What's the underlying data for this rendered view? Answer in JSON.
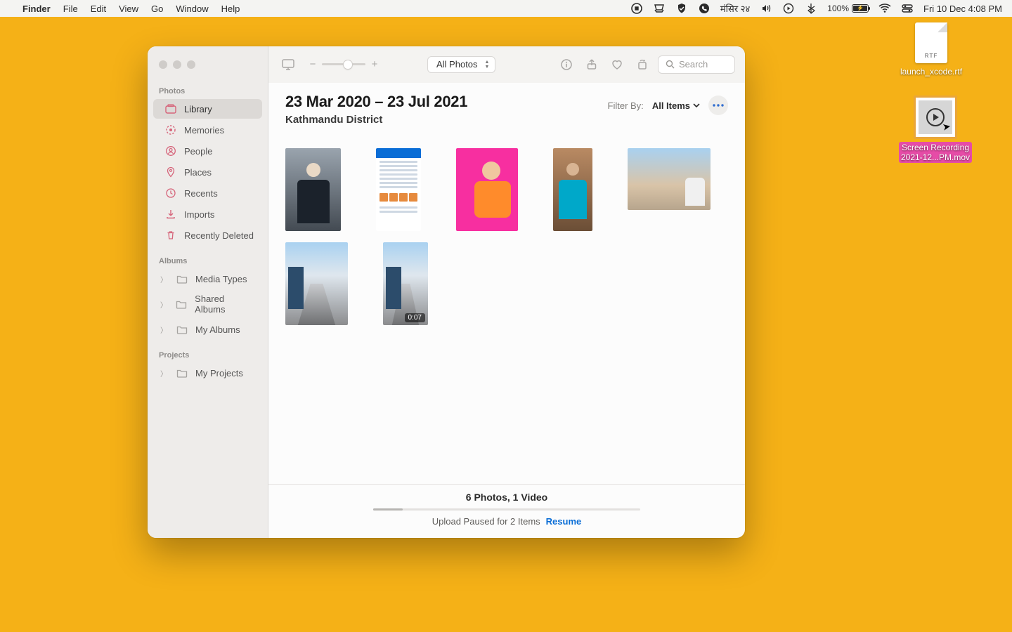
{
  "menubar": {
    "app_name": "Finder",
    "menus": [
      "File",
      "Edit",
      "View",
      "Go",
      "Window",
      "Help"
    ],
    "status": {
      "date_text": "मंसिर २४",
      "battery_pct": "100%",
      "clock": "Fri 10 Dec  4:08 PM"
    }
  },
  "window": {
    "traffic_lights": [
      "close",
      "minimize",
      "zoom"
    ],
    "sidebar": {
      "sections": [
        {
          "label": "Photos",
          "items": [
            {
              "icon": "photos-icon",
              "label": "Library",
              "active": true
            },
            {
              "icon": "memories-icon",
              "label": "Memories"
            },
            {
              "icon": "people-icon",
              "label": "People"
            },
            {
              "icon": "places-icon",
              "label": "Places"
            },
            {
              "icon": "recents-icon",
              "label": "Recents"
            },
            {
              "icon": "imports-icon",
              "label": "Imports"
            },
            {
              "icon": "trash-icon",
              "label": "Recently Deleted"
            }
          ]
        },
        {
          "label": "Albums",
          "items": [
            {
              "icon": "folder-icon",
              "label": "Media Types",
              "collapsible": true
            },
            {
              "icon": "folder-icon",
              "label": "Shared Albums",
              "collapsible": true
            },
            {
              "icon": "folder-icon",
              "label": "My Albums",
              "collapsible": true
            }
          ]
        },
        {
          "label": "Projects",
          "items": [
            {
              "icon": "folder-icon",
              "label": "My Projects",
              "collapsible": true
            }
          ]
        }
      ]
    },
    "toolbar": {
      "view_select_label": "All Photos",
      "zoom_minus": "−",
      "zoom_plus": "+",
      "search_placeholder": "Search"
    },
    "header": {
      "title": "23 Mar 2020 – 23 Jul 2021",
      "subtitle": "Kathmandu District",
      "filter_label": "Filter By:",
      "filter_value": "All Items"
    },
    "grid": {
      "items": [
        {
          "kind": "photo"
        },
        {
          "kind": "photo"
        },
        {
          "kind": "photo"
        },
        {
          "kind": "photo"
        },
        {
          "kind": "photo"
        },
        {
          "kind": "photo"
        },
        {
          "kind": "video",
          "duration": "0:07"
        }
      ]
    },
    "footer": {
      "count_text": "6 Photos, 1 Video",
      "status_text": "Upload Paused for 2 Items",
      "resume_label": "Resume"
    }
  },
  "desktop_icons": {
    "rtf": {
      "badge": "RTF",
      "label": "launch_xcode.rtf"
    },
    "mov": {
      "label_line1": "Screen Recording",
      "label_line2": "2021-12...PM.mov"
    }
  }
}
